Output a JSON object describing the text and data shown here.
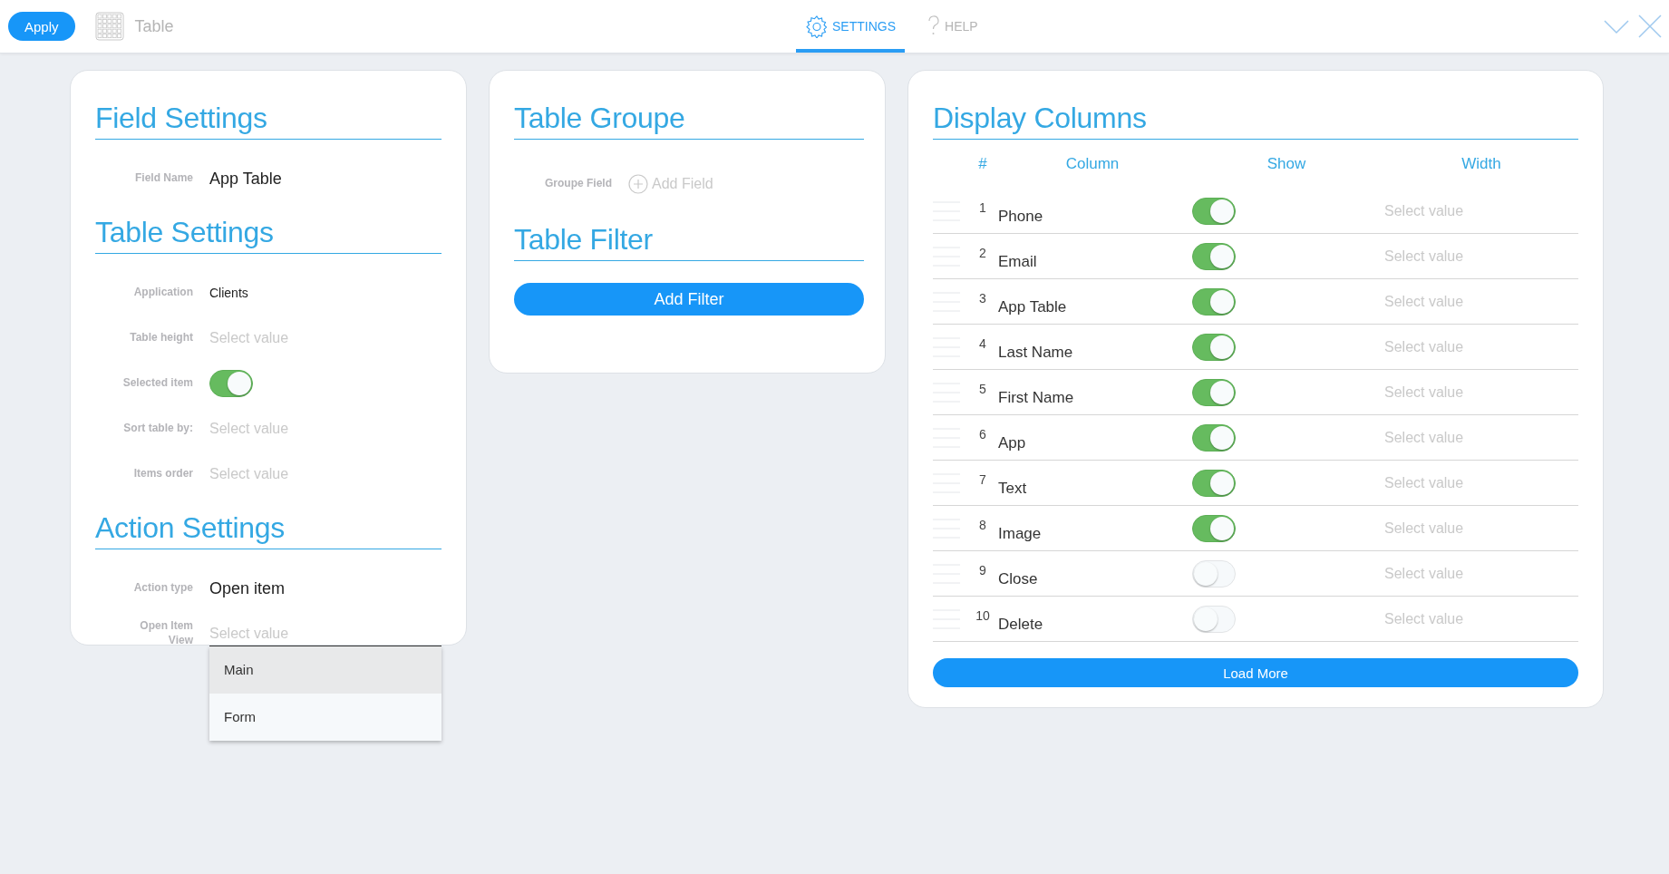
{
  "top_bar": {
    "apply_button": "Apply",
    "title": "Table",
    "tabs": [
      {
        "label": "SETTINGS",
        "kind": "settings",
        "selected": true
      },
      {
        "label": "HELP",
        "kind": "help",
        "selected": false
      }
    ]
  },
  "settings_card": {
    "sections": [
      {
        "title": "Field Settings",
        "rows": [
          {
            "label": "Field Name",
            "kind": "value",
            "large": true,
            "value": "App Table"
          }
        ]
      },
      {
        "title": "Table Settings",
        "rows": [
          {
            "label": "Application",
            "kind": "value",
            "large": false,
            "value": "Clients"
          },
          {
            "label": "Table height",
            "kind": "select",
            "placeholder": "Select value"
          },
          {
            "label": "Selected item",
            "kind": "toggle",
            "on": true
          },
          {
            "label": "Sort table by:",
            "kind": "select",
            "placeholder": "Select value"
          },
          {
            "label": "Items order",
            "kind": "select",
            "placeholder": "Select value"
          }
        ]
      },
      {
        "title": "Action Settings",
        "rows": [
          {
            "label": "Action type",
            "kind": "value",
            "large": true,
            "value": "Open item"
          },
          {
            "label": "Open Item\nView",
            "kind": "dropdown",
            "placeholder": "Select value",
            "options": [
              {
                "label": "Main",
                "selected": true
              },
              {
                "label": "Form",
                "selected": false
              }
            ]
          }
        ]
      }
    ]
  },
  "group_card": {
    "sections": [
      {
        "title": "Table Groupe",
        "rows": [
          {
            "label": "Groupe Field",
            "kind": "add",
            "value": "Add Field"
          }
        ]
      },
      {
        "title": "Table Filter",
        "button": "Add Filter"
      }
    ]
  },
  "columns_card": {
    "title": "Display Columns",
    "headers": [
      "#",
      "Column",
      "Show",
      "Width"
    ],
    "rows": [
      {
        "number": "1",
        "name": "Phone",
        "show": true,
        "width": "Select value"
      },
      {
        "number": "2",
        "name": "Email",
        "show": true,
        "width": "Select value"
      },
      {
        "number": "3",
        "name": "App Table",
        "show": true,
        "width": "Select value"
      },
      {
        "number": "4",
        "name": "Last Name",
        "show": true,
        "width": "Select value"
      },
      {
        "number": "5",
        "name": "First Name",
        "show": true,
        "width": "Select value"
      },
      {
        "number": "6",
        "name": "App",
        "show": true,
        "width": "Select value"
      },
      {
        "number": "7",
        "name": "Text",
        "show": true,
        "width": "Select value"
      },
      {
        "number": "8",
        "name": "Image",
        "show": true,
        "width": "Select value"
      },
      {
        "number": "9",
        "name": "Close",
        "show": false,
        "width": "Select value"
      },
      {
        "number": "10",
        "name": "Delete",
        "show": false,
        "width": "Select value"
      }
    ],
    "button": "Load More"
  }
}
